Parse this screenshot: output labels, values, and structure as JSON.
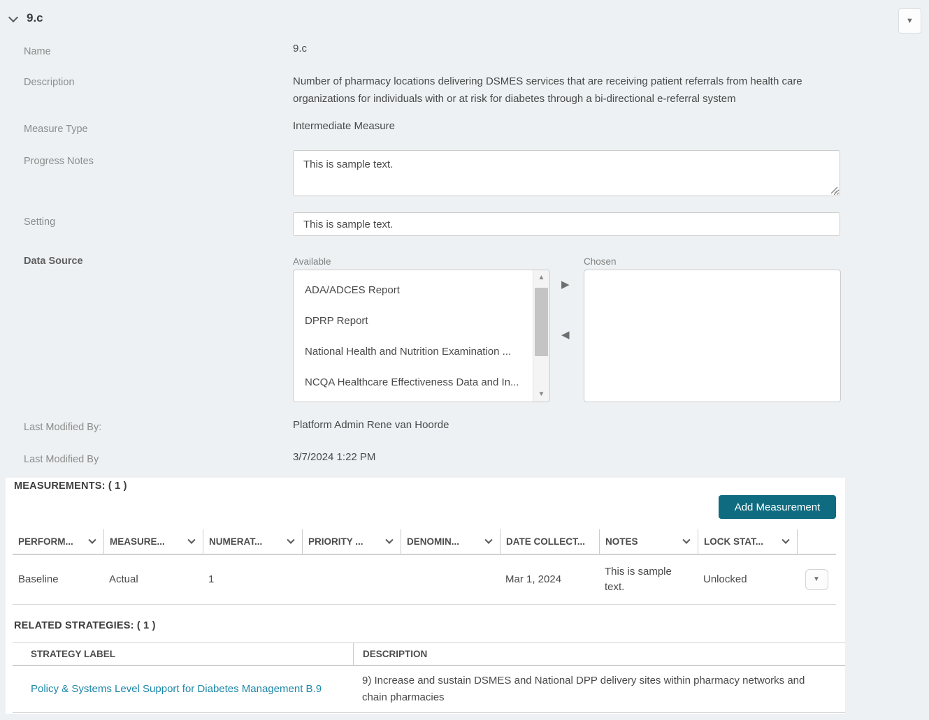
{
  "header": {
    "title": "9.c"
  },
  "icons": {
    "title_chevron": "chevron-down",
    "collapse_caret": "▼",
    "move_right": "▶",
    "move_left": "◀",
    "scroll_up": "▲",
    "scroll_down": "▼",
    "row_menu_caret": "▼"
  },
  "colors": {
    "page_background": "#edf1f4",
    "panel_background": "#ffffff",
    "accent_teal": "#0e6b80",
    "link": "#1d87a8",
    "label_gray": "#8c8c8c",
    "text_dark": "#494949"
  },
  "form": {
    "name": {
      "label": "Name",
      "value": "9.c"
    },
    "description": {
      "label": "Description",
      "value": "Number of pharmacy locations delivering DSMES services that are receiving patient referrals from health care organizations for individuals with or at risk for diabetes through a bi-directional e-referral system"
    },
    "measure_type": {
      "label": "Measure Type",
      "value": "Intermediate Measure"
    },
    "progress_notes": {
      "label": "Progress Notes",
      "value": "This is sample text."
    },
    "setting": {
      "label": "Setting",
      "value": "This is sample text."
    },
    "data_source": {
      "label": "Data Source",
      "available_label": "Available",
      "chosen_label": "Chosen",
      "available_items": [
        "ADA/ADCES Report",
        "DPRP Report",
        "National Health and Nutrition Examination ...",
        "NCQA Healthcare Effectiveness Data and In..."
      ],
      "chosen_items": []
    },
    "last_modified_by": {
      "label": "Last Modified By:",
      "value": "Platform Admin Rene van Hoorde"
    },
    "last_modified_date": {
      "label": "Last Modified By",
      "value": "3/7/2024 1:22 PM"
    }
  },
  "measurements": {
    "title": "MEASUREMENTS: ( 1 )",
    "add_button_label": "Add Measurement",
    "columns": [
      {
        "label": "PERFORM...",
        "sortable": true
      },
      {
        "label": "MEASURE...",
        "sortable": true
      },
      {
        "label": "NUMERAT...",
        "sortable": true
      },
      {
        "label": "PRIORITY ...",
        "sortable": true
      },
      {
        "label": "DENOMIN...",
        "sortable": true
      },
      {
        "label": "DATE COLLECT...",
        "sortable": false
      },
      {
        "label": "NOTES",
        "sortable": true
      },
      {
        "label": "LOCK STAT...",
        "sortable": true
      }
    ],
    "rows": [
      {
        "performance": "Baseline",
        "measure": "Actual",
        "numerator": "1",
        "priority": "",
        "denominator": "",
        "date_collected": "Mar 1, 2024",
        "notes": "This is sample text.",
        "lock_status": "Unlocked"
      }
    ]
  },
  "related_strategies": {
    "title": "RELATED STRATEGIES: ( 1 )",
    "columns": {
      "label": "STRATEGY LABEL",
      "description": "DESCRIPTION"
    },
    "rows": [
      {
        "label": "Policy & Systems Level Support for Diabetes Management B.9",
        "description": "9) Increase and sustain DSMES and National DPP delivery sites within pharmacy networks and chain pharmacies"
      }
    ]
  }
}
